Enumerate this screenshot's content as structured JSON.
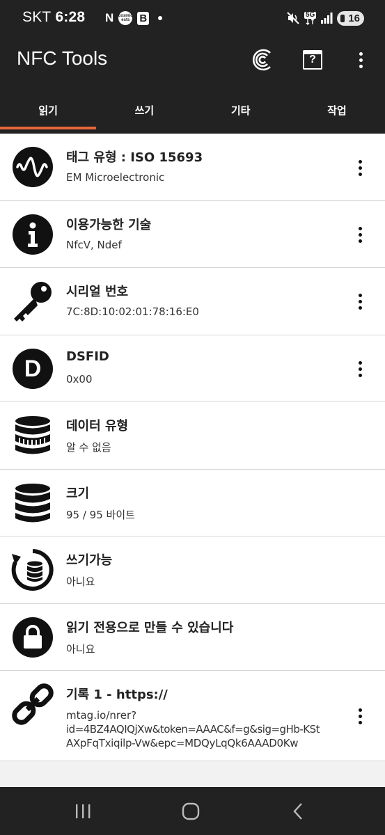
{
  "status_bar": {
    "carrier": "SKT",
    "time": "6:28",
    "left_icons": [
      "nfc-n-icon",
      "cosmic-ests-icon",
      "b-app-icon",
      "notification-dot"
    ],
    "cosmic_label": "cosmic ests",
    "n_label": "N",
    "b_label": "B",
    "network": "5G",
    "battery": "16"
  },
  "app_bar": {
    "title": "NFC Tools",
    "actions": [
      "nfc-signal-icon",
      "help-icon",
      "more-vert-icon"
    ],
    "help_label": "?"
  },
  "tabs": [
    {
      "label": "읽기",
      "active": true
    },
    {
      "label": "쓰기",
      "active": false
    },
    {
      "label": "기타",
      "active": false
    },
    {
      "label": "작업",
      "active": false
    }
  ],
  "accent_color": "#e8663c",
  "items": [
    {
      "icon": "waveform-icon",
      "title": "태그 유형 : ISO 15693",
      "subtitle": "EM Microelectronic",
      "has_menu": true
    },
    {
      "icon": "info-icon",
      "title": "이용가능한 기술",
      "subtitle": "NfcV, Ndef",
      "has_menu": true
    },
    {
      "icon": "key-icon",
      "title": "시리얼 번호",
      "subtitle": "7C:8D:10:02:01:78:16:E0",
      "has_menu": true
    },
    {
      "icon": "dsfid-d-icon",
      "title": "DSFID",
      "subtitle": "0x00",
      "has_menu": true,
      "icon_letter": "D"
    },
    {
      "icon": "database-striped-icon",
      "title": "데이터 유형",
      "subtitle": "알 수 없음",
      "has_menu": false
    },
    {
      "icon": "database-icon",
      "title": "크기",
      "subtitle": "95 / 95 바이트",
      "has_menu": false
    },
    {
      "icon": "database-refresh-icon",
      "title": "쓰기가능",
      "subtitle": "아니요",
      "has_menu": false
    },
    {
      "icon": "lock-icon",
      "title": "읽기 전용으로 만들 수 있습니다",
      "subtitle": "아니요",
      "has_menu": false
    },
    {
      "icon": "link-icon",
      "title": "기록 1 - https://",
      "subtitle_lines": [
        "mtag.io/nrer?",
        "id=4BZ4AQIQjXw&token=AAAC&f=g&sig=gHb-KSt",
        "AXpFqTxiqilp-Vw&epc=MDQyLqQk6AAAD0Kw"
      ],
      "has_menu": true
    }
  ],
  "nav_bar": [
    "recents-button",
    "home-button",
    "back-button"
  ]
}
